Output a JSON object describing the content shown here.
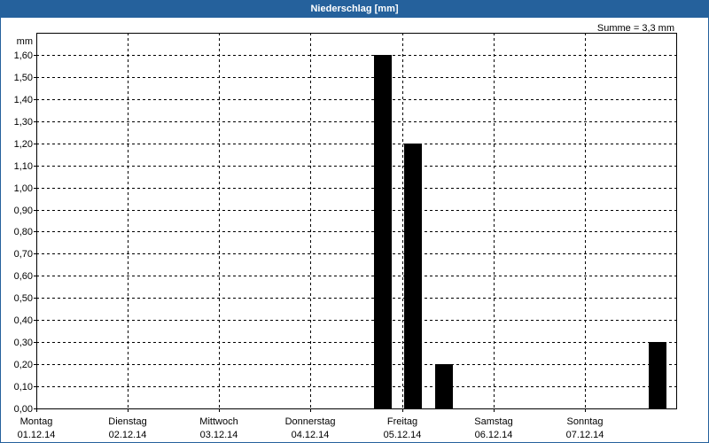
{
  "colors": {
    "title_bar": "#25619c",
    "bars": "#000000",
    "grid": "#000000"
  },
  "chart_data": {
    "type": "bar",
    "title": "Niederschlag [mm]",
    "ylabel": "mm",
    "annotation": "Summe = 3,3 mm",
    "ylim": [
      0,
      1.7
    ],
    "yticks": [
      "0,00",
      "0,10",
      "0,20",
      "0,30",
      "0,40",
      "0,50",
      "0,60",
      "0,70",
      "0,80",
      "0,90",
      "1,00",
      "1,10",
      "1,20",
      "1,30",
      "1,40",
      "1,50",
      "1,60"
    ],
    "xticks": [
      {
        "day": "Montag",
        "date": "01.12.14"
      },
      {
        "day": "Dienstag",
        "date": "02.12.14"
      },
      {
        "day": "Mittwoch",
        "date": "03.12.14"
      },
      {
        "day": "Donnerstag",
        "date": "04.12.14"
      },
      {
        "day": "Freitag",
        "date": "05.12.14"
      },
      {
        "day": "Samstag",
        "date": "06.12.14"
      },
      {
        "day": "Sonntag",
        "date": "07.12.14"
      }
    ],
    "points": [
      {
        "x": "04.12.14 19:00",
        "y": 1.6
      },
      {
        "x": "05.12.14 03:00",
        "y": 1.2
      },
      {
        "x": "05.12.14 11:00",
        "y": 0.2
      },
      {
        "x": "07.12.14 19:00",
        "y": 0.3
      }
    ],
    "grid": true
  }
}
